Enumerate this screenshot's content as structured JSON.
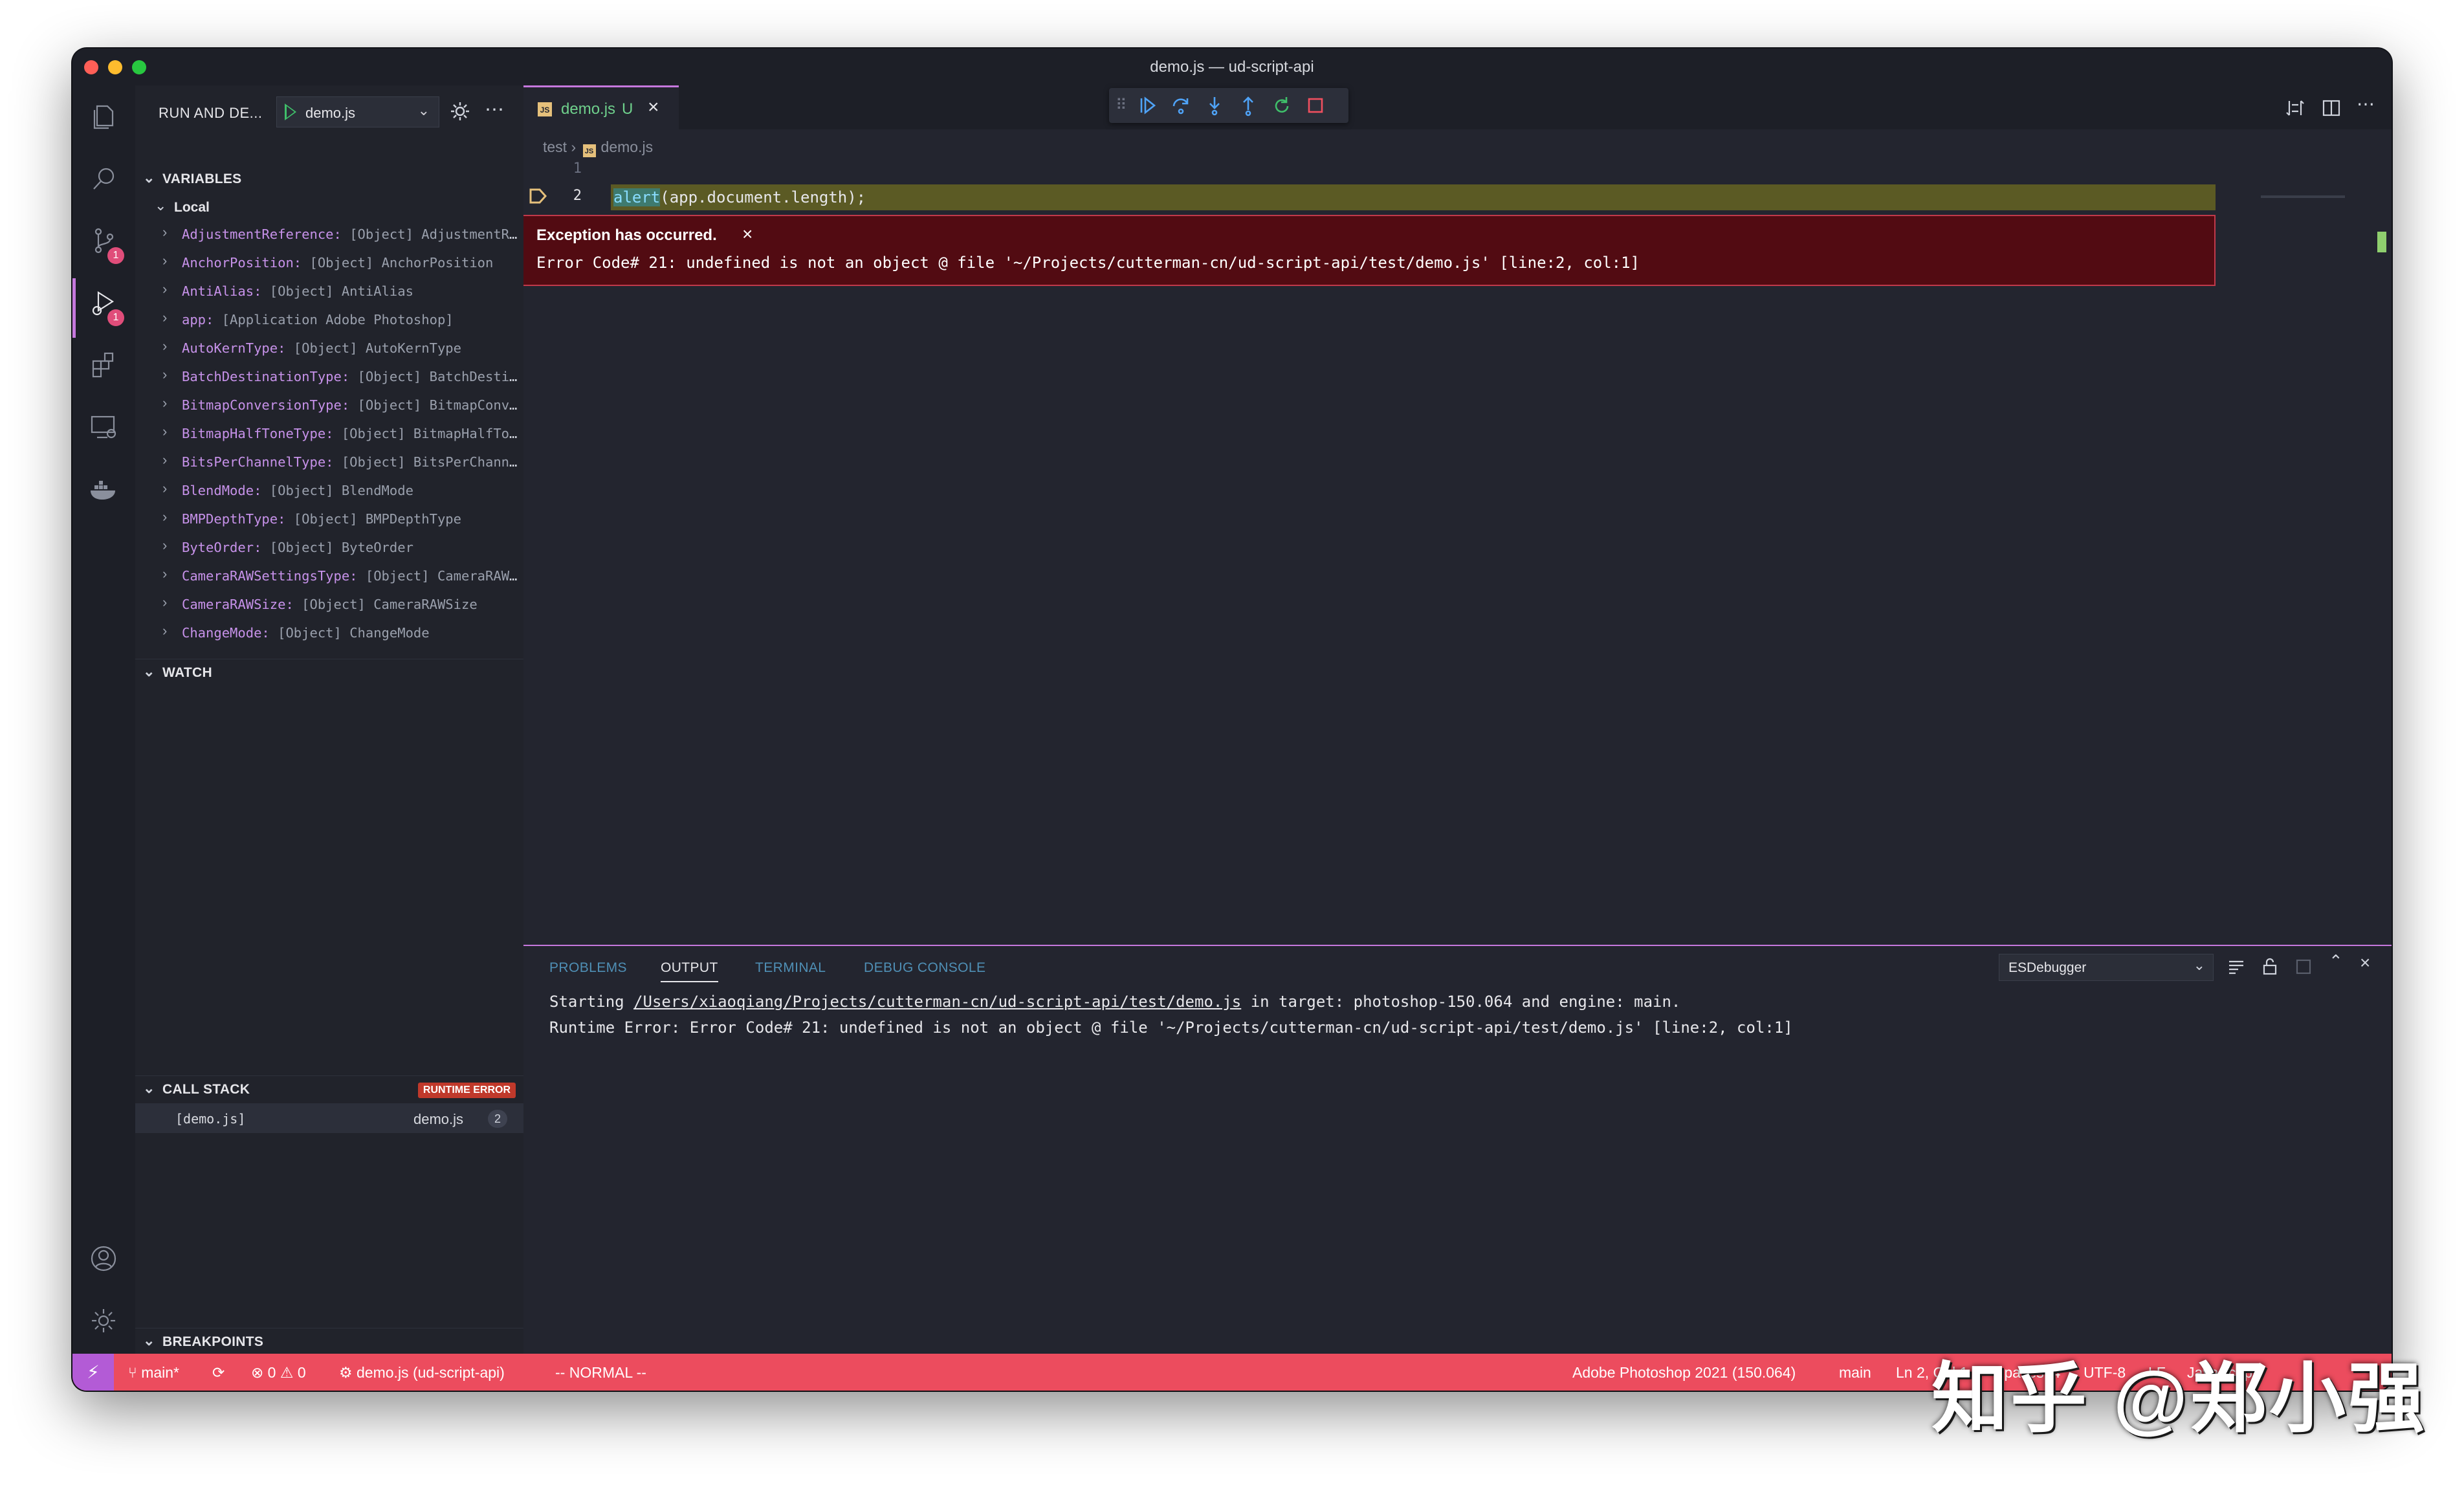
{
  "window": {
    "title": "demo.js — ud-script-api"
  },
  "sidebar": {
    "title": "RUN AND DE...",
    "config": "demo.js",
    "sections": {
      "variables": "VARIABLES",
      "local": "Local",
      "watch": "WATCH",
      "call_stack": "CALL STACK",
      "call_stack_badge": "RUNTIME ERROR",
      "breakpoints": "BREAKPOINTS"
    },
    "variables": [
      {
        "name": "AdjustmentReference:",
        "value": "[Object] AdjustmentReference"
      },
      {
        "name": "AnchorPosition:",
        "value": "[Object] AnchorPosition"
      },
      {
        "name": "AntiAlias:",
        "value": "[Object] AntiAlias"
      },
      {
        "name": "app:",
        "value": "[Application Adobe Photoshop]"
      },
      {
        "name": "AutoKernType:",
        "value": "[Object] AutoKernType"
      },
      {
        "name": "BatchDestinationType:",
        "value": "[Object] BatchDestinationType"
      },
      {
        "name": "BitmapConversionType:",
        "value": "[Object] BitmapConversionType"
      },
      {
        "name": "BitmapHalfToneType:",
        "value": "[Object] BitmapHalfToneType"
      },
      {
        "name": "BitsPerChannelType:",
        "value": "[Object] BitsPerChannelType"
      },
      {
        "name": "BlendMode:",
        "value": "[Object] BlendMode"
      },
      {
        "name": "BMPDepthType:",
        "value": "[Object] BMPDepthType"
      },
      {
        "name": "ByteOrder:",
        "value": "[Object] ByteOrder"
      },
      {
        "name": "CameraRAWSettingsType:",
        "value": "[Object] CameraRAWSettingsType"
      },
      {
        "name": "CameraRAWSize:",
        "value": "[Object] CameraRAWSize"
      },
      {
        "name": "ChangeMode:",
        "value": "[Object] ChangeMode"
      }
    ],
    "call_stack": [
      {
        "frame": "[demo.js]",
        "file": "demo.js",
        "line": "2"
      }
    ]
  },
  "editor": {
    "tab": {
      "name": "demo.js",
      "status": "U"
    },
    "breadcrumb": [
      "test",
      "demo.js"
    ],
    "lines": [
      "1",
      "2"
    ],
    "code": {
      "keyword": "alert",
      "rest": "(app.document.length);"
    },
    "exception": {
      "title": "Exception has occurred.",
      "message": "Error Code# 21: undefined is not an object @ file '~/Projects/cutterman-cn/ud-script-api/test/demo.js' [line:2, col:1]"
    }
  },
  "panel": {
    "tabs": [
      "PROBLEMS",
      "OUTPUT",
      "TERMINAL",
      "DEBUG CONSOLE"
    ],
    "active_tab": "OUTPUT",
    "channel": "ESDebugger",
    "output": {
      "line1_prefix": "Starting ",
      "line1_path": "/Users/xiaoqiang/Projects/cutterman-cn/ud-script-api/test/demo.js",
      "line1_suffix": " in target: photoshop-150.064 and engine: main.",
      "line2": "Runtime Error: Error Code# 21: undefined is not an object @ file '~/Projects/cutterman-cn/ud-script-api/test/demo.js' [line:2, col:1]"
    }
  },
  "statusbar": {
    "branch": "main*",
    "errors": "0",
    "warnings": "0",
    "debug_target": "demo.js (ud-script-api)",
    "mode": "-- NORMAL --",
    "target_app": "Adobe Photoshop 2021 (150.064)",
    "engine": "main",
    "position": "Ln 2, Col 1",
    "spaces": "Spaces: 4",
    "encoding": "UTF-8",
    "eol": "LF",
    "language": "JavaScript"
  },
  "watermark": "知乎 @郑小强",
  "colors": {
    "accent": "#c678dd",
    "statusbar": "#ec4c5e",
    "exception_bg": "#520b12",
    "current_line": "#5b5a24"
  },
  "icons": [
    "explorer-icon",
    "search-icon",
    "source-control-icon",
    "run-debug-icon",
    "extensions-icon",
    "remote-explorer-icon",
    "docker-icon",
    "account-icon",
    "manage-gear-icon"
  ]
}
